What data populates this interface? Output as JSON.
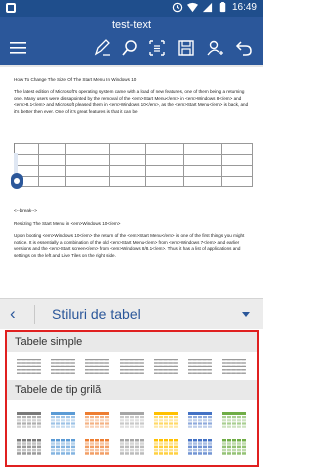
{
  "status": {
    "time": "16:49"
  },
  "app": {
    "title": "test-text"
  },
  "doc": {
    "heading": "How To Change The Size Of The Start Menu In Windows 10",
    "para1": "The latest edition of Microsoft's operating system came with a load of new features, one of them being a returning one. Many users were dissapointed by the removal of the <em>Start Menu</em> in <em>Windows 8</em> and <em>8.1</em> and Microsoft pleased them in <em>Windows 10</em>, as the <em>Start Menu</em> is back, and it's better then ever. One of it's great features is that it can be",
    "break": "<--break-->",
    "sub": "Resizing The Start Menu in <em>Windows 10</em>",
    "para2": "Upon booting <em>Windows 10</em> the return of the <em>Start Menu</em> is one of the first things you might notice. It is essentially a combination of the old <em>Start Menu</em> from <em>Windows 7</em> and earlier versions and the <em>Start screen</em> from <em>Windows 8/8.1</em>. Thus it has a list of applications and settings on the left and Live Tiles on the right side."
  },
  "panel": {
    "title": "Stiluri de tabel"
  },
  "gallery": {
    "section1": "Tabele simple",
    "section2": "Tabele de tip grilă",
    "simple_colors": [
      "#9a9a9a",
      "#9a9a9a",
      "#9a9a9a",
      "#9a9a9a",
      "#9a9a9a",
      "#9a9a9a",
      "#9a9a9a"
    ],
    "grid_row1_colors": [
      "#7a7a7a",
      "#5b9bd5",
      "#ed7d31",
      "#a5a5a5",
      "#ffc000",
      "#4472c4",
      "#70ad47"
    ],
    "grid_row2_colors": [
      "#7a7a7a",
      "#5b9bd5",
      "#ed7d31",
      "#a5a5a5",
      "#ffc000",
      "#4472c4",
      "#70ad47"
    ]
  },
  "colors": {
    "brand": "#2b579a",
    "statusbar": "#1f4e8c",
    "highlight": "#e02020"
  }
}
